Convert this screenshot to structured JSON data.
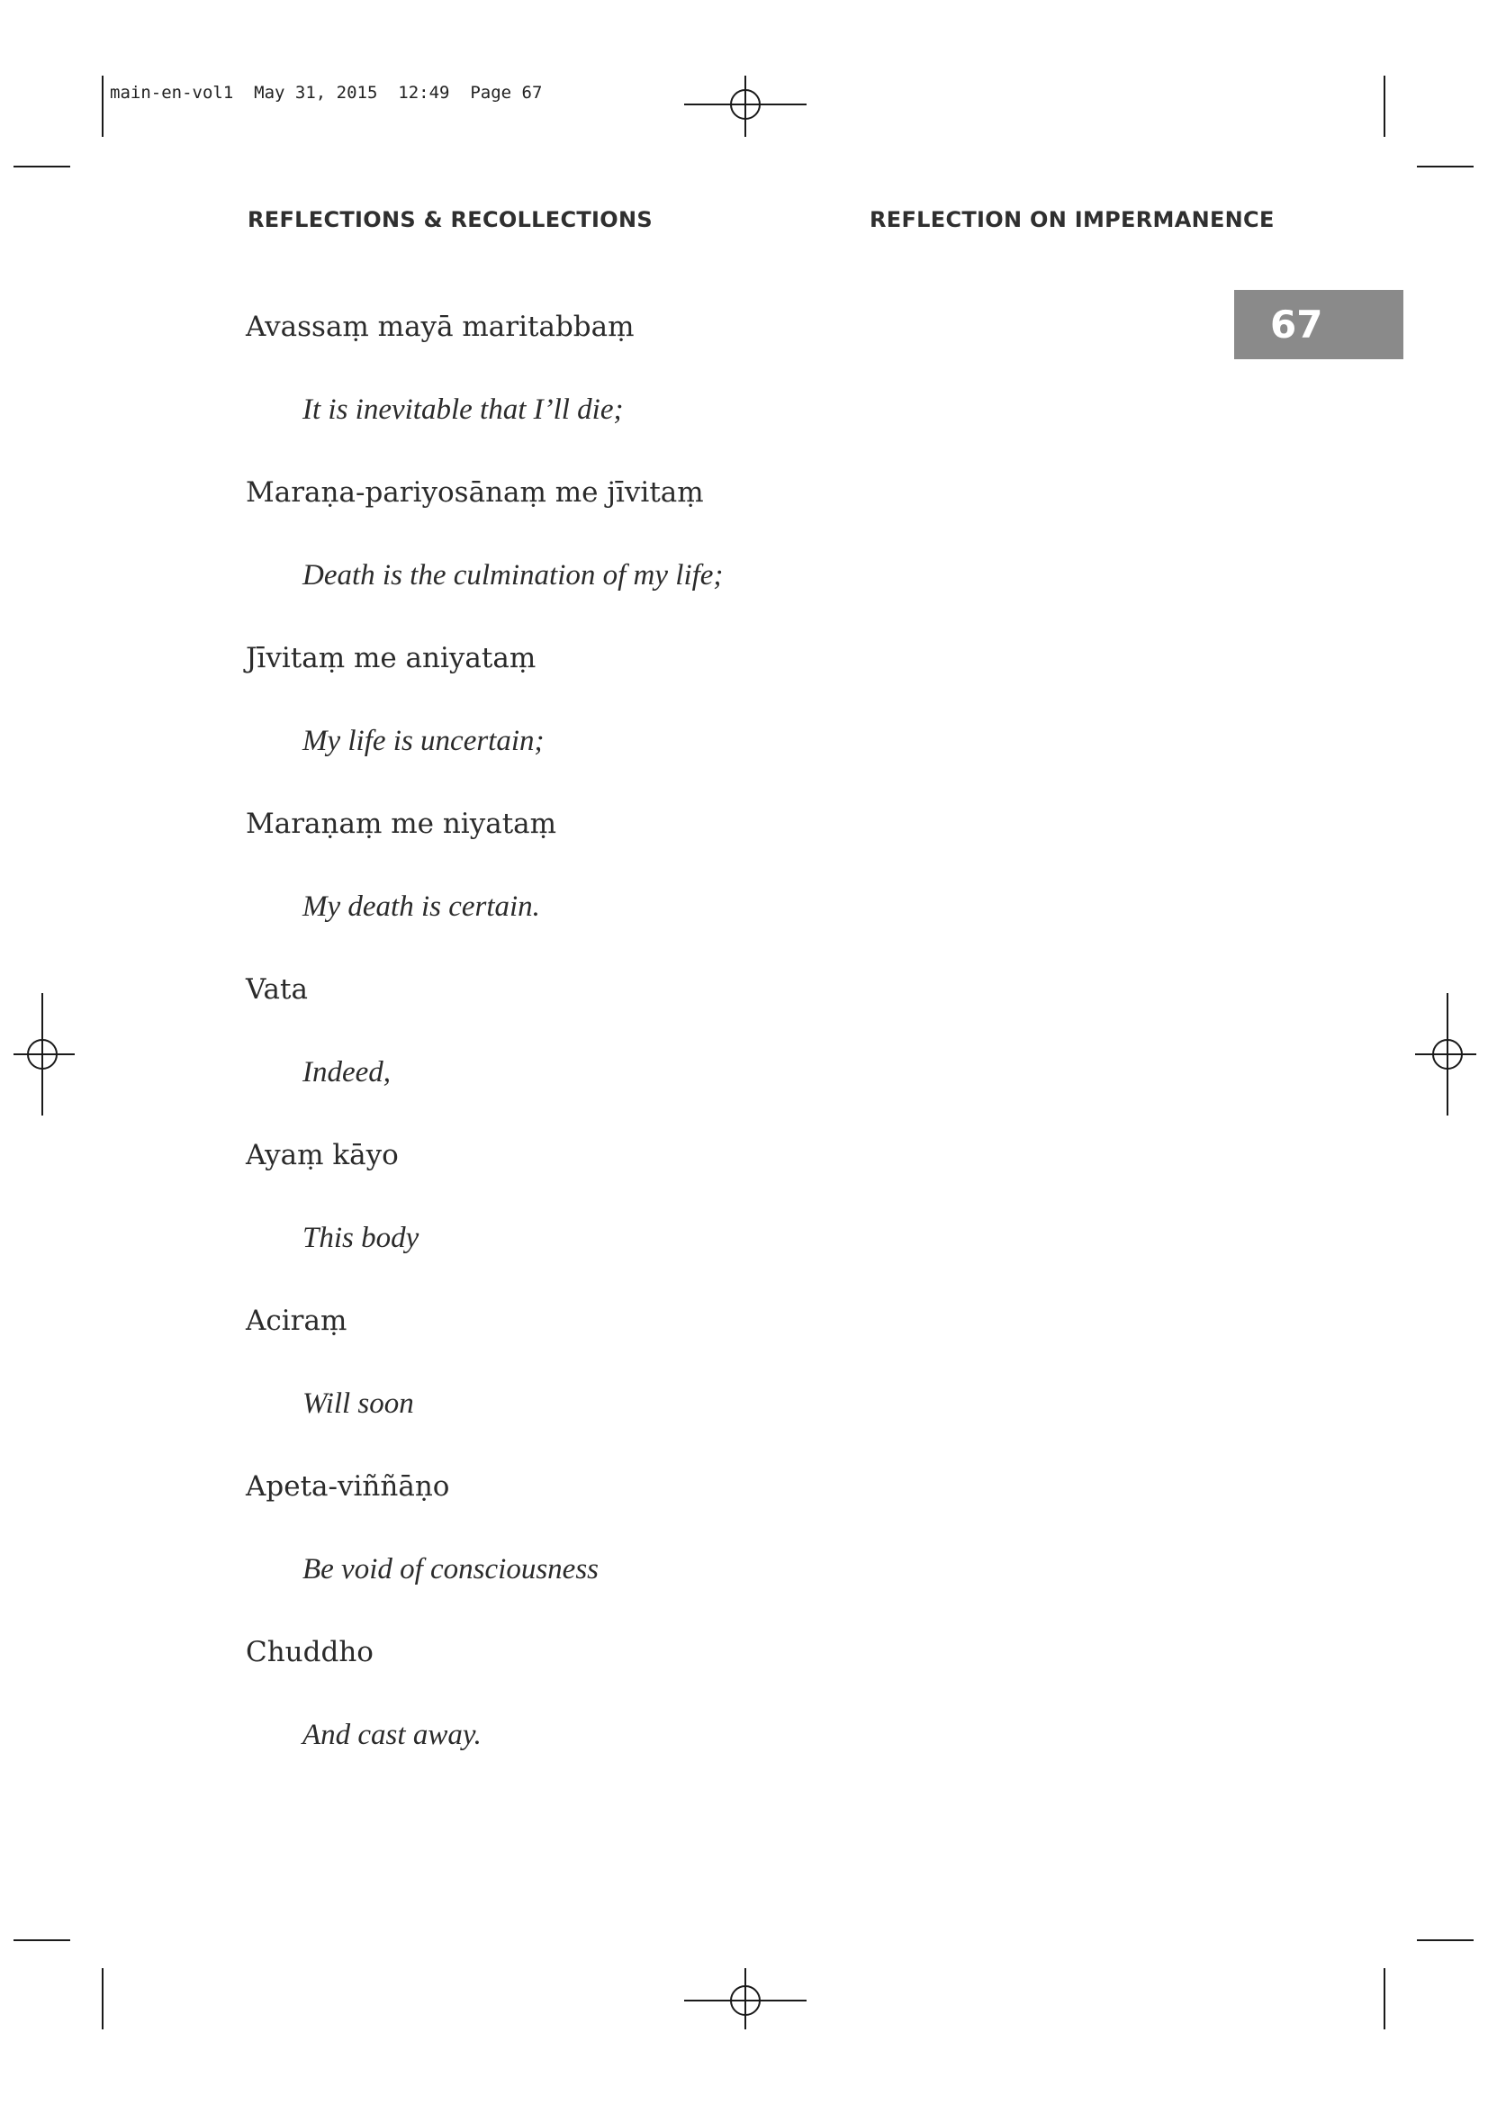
{
  "slug": "main-en-vol1  May 31, 2015  12:49  Page 67",
  "running_head": {
    "left": "REFLECTIONS & RECOLLECTIONS",
    "right": "REFLECTION ON IMPERMANENCE"
  },
  "page_number": "67",
  "lines": [
    {
      "pali": "Avassaṃ mayā maritabbaṃ",
      "english": "It is inevitable that I’ll die;"
    },
    {
      "pali": "Maraṇa-pariyosānaṃ me jīvitaṃ",
      "english": "Death is the culmination of my life;"
    },
    {
      "pali": "Jīvitaṃ me aniyataṃ",
      "english": "My life is uncertain;"
    },
    {
      "pali": "Maraṇaṃ me niyataṃ",
      "english": "My death is certain."
    },
    {
      "pali": "Vata",
      "english": "Indeed,"
    },
    {
      "pali": "Ayaṃ kāyo",
      "english": "This body"
    },
    {
      "pali": "Aciraṃ",
      "english": "Will soon"
    },
    {
      "pali": "Apeta-viññāṇo",
      "english": "Be void of consciousness"
    },
    {
      "pali": "Chuddho",
      "english": "And cast away."
    }
  ]
}
